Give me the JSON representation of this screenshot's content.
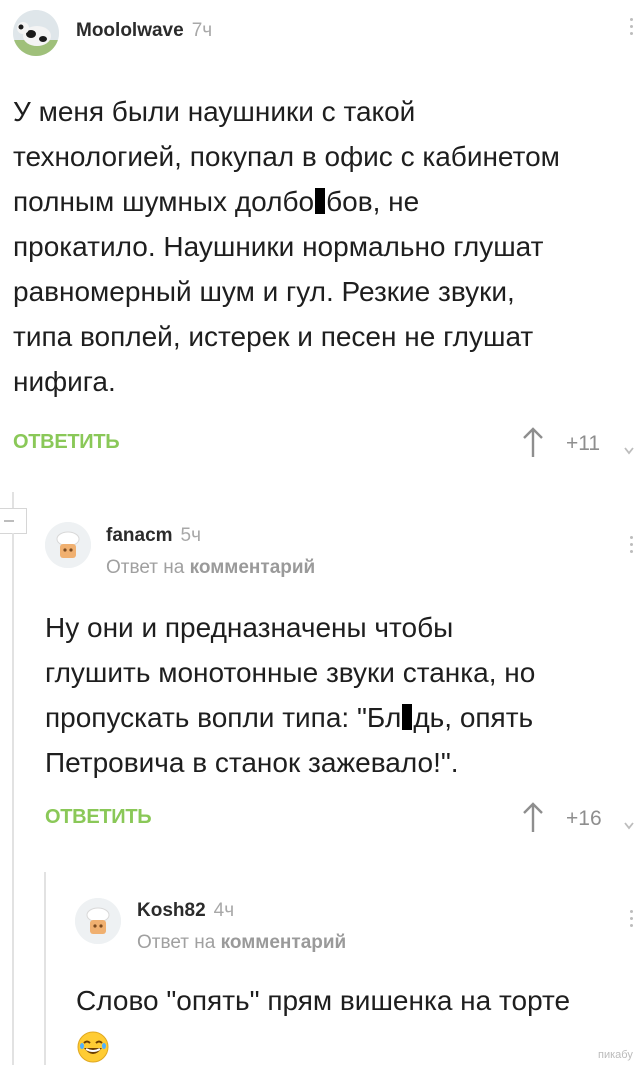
{
  "comment1": {
    "user": "Moololwave",
    "time": "7ч",
    "text_lines": [
      "У меня были наушники с такой",
      "технологией, покупал в офис с кабинетом"
    ],
    "line3_a": "полным шумных долбо",
    "line3_b": "бов, не",
    "text_lines_rest": [
      "прокатило. Наушники нормально глушат",
      "равномерный шум и гул. Резкие звуки,",
      "типа воплей, истерек и песен не глушат",
      "нифига."
    ],
    "reply_label": "ОТВЕТИТЬ",
    "rating": "+11"
  },
  "comment2": {
    "user": "fanacm",
    "time": "5ч",
    "reply_prefix": "Ответ на",
    "reply_target": "комментарий",
    "text_lines": [
      "Ну они и предназначены чтобы",
      "глушить монотонные звуки станка, но"
    ],
    "line3_a": "пропускать вопли типа: \"Бл",
    "line3_b": "дь, опять",
    "text_line4": "Петровича в станок зажевало!\".",
    "reply_label": "ОТВЕТИТЬ",
    "rating": "+16"
  },
  "comment3": {
    "user": "Kosh82",
    "time": "4ч",
    "reply_prefix": "Ответ на",
    "reply_target": "комментарий",
    "text_line1": "Слово \"опять\" прям вишенка на торте",
    "emoji": "😂"
  },
  "watermark": "пикабу",
  "icons": {
    "upvote": "up-arrow-icon",
    "collapse": "collapse-minus-icon",
    "more": "more-dots-icon"
  },
  "colors": {
    "reply_button": "#8ac858",
    "muted": "#a8a8a8"
  }
}
